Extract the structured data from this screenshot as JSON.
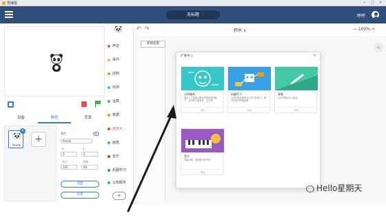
{
  "titlebar": {
    "app_title": "慧编程",
    "win_controls": [
      "—",
      "□",
      "✕"
    ]
  },
  "menubar": {
    "project_name": "无标题",
    "user_label": "呼呼"
  },
  "stage": {
    "sprite_name": "Panda"
  },
  "tabs": [
    "设备",
    "角色",
    "背景"
  ],
  "sprite_panel": {
    "sprite_label": "Panda",
    "role_label": "角色",
    "name_value": "Panda",
    "x_label": "x",
    "y_label": "y",
    "x_value": "0",
    "y_value": "0",
    "size_label": "大小",
    "direction_label": "方向",
    "size_value": "100",
    "direction_value": "90",
    "buttons": [
      "造型",
      "声音"
    ]
  },
  "categories": [
    {
      "label": "声音",
      "color": "#c94fd3"
    },
    {
      "label": "事件",
      "color": "#f3b93a"
    },
    {
      "label": "控制",
      "color": "#f39c12"
    },
    {
      "label": "侦测",
      "color": "#4fb4e0"
    },
    {
      "label": "运算",
      "color": "#55b748"
    },
    {
      "label": "数据",
      "color": "#f08a24"
    },
    {
      "label": "自定义",
      "color": "#e74c3c"
    },
    {
      "label": "画笔",
      "color": "#2ecc71"
    },
    {
      "label": "音乐",
      "color": "#c0392b"
    },
    {
      "label": "机器学习",
      "color": "#16a085"
    },
    {
      "label": "认知服务",
      "color": "#1abc9c"
    }
  ],
  "toolbar": {
    "undo": "↶",
    "redo": "↷",
    "mode": "积木 ∨",
    "zoom": "— 100% +"
  },
  "workspace": {
    "new_variable": "新建变量",
    "side_button": "<"
  },
  "modal": {
    "title": "扩展中心",
    "close": "✕",
    "cards": [
      {
        "title": "认知服务",
        "desc": "通过人工智能让舞台有更多感知能力，如识别人脸表情、文字等",
        "foot": "添加",
        "color": "#37c7c7"
      },
      {
        "title": "机器学习",
        "desc": "让你的角色拥有可以学习的能力，通过训练识别图像等",
        "foot": "添加",
        "color": "#3aa0e6"
      },
      {
        "title": "画笔",
        "desc": "让你的角色可以绘画",
        "foot": "添加",
        "color": "#44c8a8"
      },
      {
        "title": "音乐",
        "desc": "演奏乐器，播放音乐和节拍",
        "foot": "添加",
        "color": "#9b59c6"
      }
    ]
  },
  "watermark": {
    "text": "Hello星期天"
  }
}
